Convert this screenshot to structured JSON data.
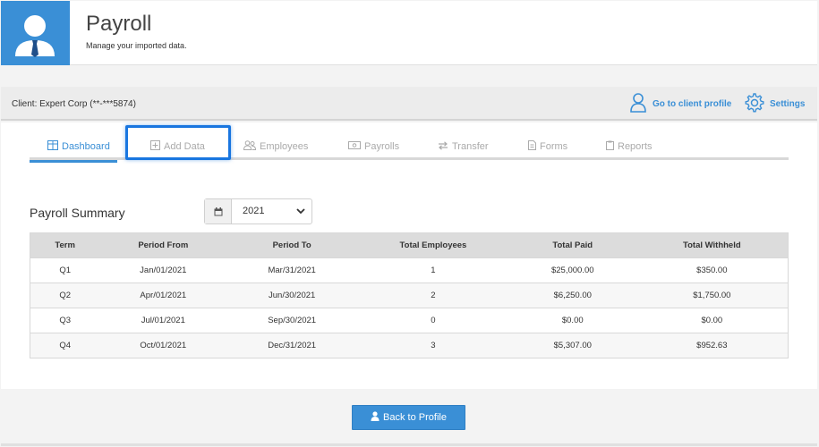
{
  "header": {
    "title": "Payroll",
    "subtitle": "Manage your imported data.",
    "icon": "user-tie-icon",
    "accent": "#3a8fd6"
  },
  "client_bar": {
    "client_label": "Client: Expert Corp (**-***5874)",
    "profile_link": "Go to client profile",
    "settings_link": "Settings"
  },
  "tabs": [
    {
      "label": "Dashboard",
      "icon": "table-icon",
      "active": true
    },
    {
      "label": "Add Data",
      "icon": "plus-square-icon",
      "active": false
    },
    {
      "label": "Employees",
      "icon": "users-icon",
      "active": false
    },
    {
      "label": "Payrolls",
      "icon": "money-icon",
      "active": false
    },
    {
      "label": "Transfer",
      "icon": "exchange-icon",
      "active": false
    },
    {
      "label": "Forms",
      "icon": "file-icon",
      "active": false
    },
    {
      "label": "Reports",
      "icon": "clipboard-icon",
      "active": false
    }
  ],
  "summary": {
    "title": "Payroll Summary",
    "year": "2021",
    "columns": [
      "Term",
      "Period From",
      "Period To",
      "Total Employees",
      "Total Paid",
      "Total Withheld"
    ],
    "rows": [
      [
        "Q1",
        "Jan/01/2021",
        "Mar/31/2021",
        "1",
        "$25,000.00",
        "$350.00"
      ],
      [
        "Q2",
        "Apr/01/2021",
        "Jun/30/2021",
        "2",
        "$6,250.00",
        "$1,750.00"
      ],
      [
        "Q3",
        "Jul/01/2021",
        "Sep/30/2021",
        "0",
        "$0.00",
        "$0.00"
      ],
      [
        "Q4",
        "Oct/01/2021",
        "Dec/31/2021",
        "3",
        "$5,307.00",
        "$952.63"
      ]
    ]
  },
  "footer": {
    "back_button": "Back to Profile"
  }
}
